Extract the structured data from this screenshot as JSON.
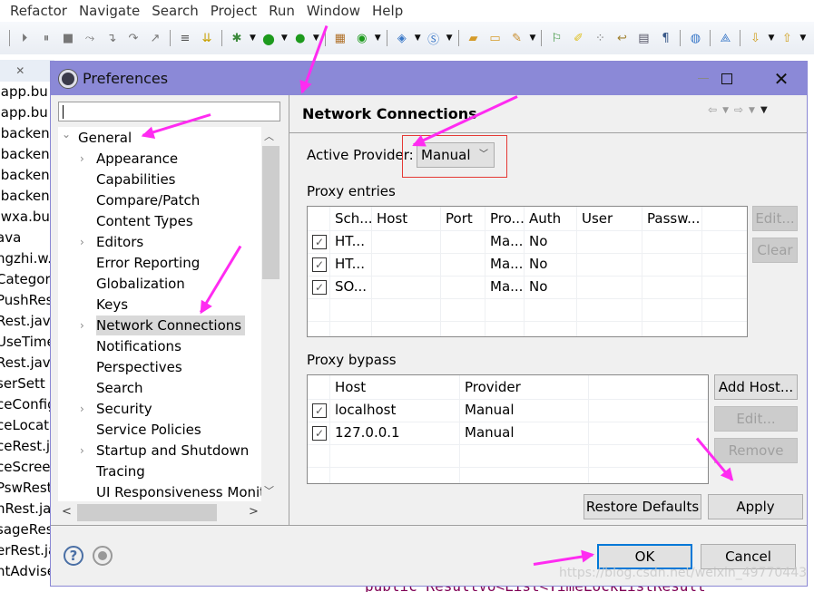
{
  "menubar": {
    "items": [
      "Refactor",
      "Navigate",
      "Search",
      "Project",
      "Run",
      "Window",
      "Help"
    ]
  },
  "background_editor": {
    "files": [
      ".app.bu",
      ".app.bu",
      ".backen",
      ".backen",
      ".backen",
      ".backen",
      ".wxa.bu",
      "ava",
      "ngzhi.w.",
      "Categor",
      "PushRes",
      "Rest.java",
      "UseTime",
      "Rest.jav",
      "serSett",
      "ceConfig",
      "ceLocat",
      "ceRest.j",
      "ceScree",
      "PswRest",
      "nRest.ja",
      "sageRes",
      "erRest.ja",
      "ntAdvise"
    ],
    "code_line": "public ResultVo<List<TimeLockListResult"
  },
  "dialog": {
    "title": "Preferences",
    "search": {
      "value": "",
      "placeholder": ""
    },
    "tree": [
      {
        "label": "General",
        "level": 0,
        "expander": "expanded"
      },
      {
        "label": "Appearance",
        "level": 1,
        "expander": "collapsed"
      },
      {
        "label": "Capabilities",
        "level": 1,
        "expander": "none"
      },
      {
        "label": "Compare/Patch",
        "level": 1,
        "expander": "none"
      },
      {
        "label": "Content Types",
        "level": 1,
        "expander": "none"
      },
      {
        "label": "Editors",
        "level": 1,
        "expander": "collapsed"
      },
      {
        "label": "Error Reporting",
        "level": 1,
        "expander": "none"
      },
      {
        "label": "Globalization",
        "level": 1,
        "expander": "none"
      },
      {
        "label": "Keys",
        "level": 1,
        "expander": "none"
      },
      {
        "label": "Network Connections",
        "level": 1,
        "expander": "collapsed",
        "selected": true
      },
      {
        "label": "Notifications",
        "level": 1,
        "expander": "none"
      },
      {
        "label": "Perspectives",
        "level": 1,
        "expander": "none"
      },
      {
        "label": "Search",
        "level": 1,
        "expander": "none"
      },
      {
        "label": "Security",
        "level": 1,
        "expander": "collapsed"
      },
      {
        "label": "Service Policies",
        "level": 1,
        "expander": "none"
      },
      {
        "label": "Startup and Shutdown",
        "level": 1,
        "expander": "collapsed"
      },
      {
        "label": "Tracing",
        "level": 1,
        "expander": "none"
      },
      {
        "label": "UI Responsiveness Monit",
        "level": 1,
        "expander": "none"
      }
    ],
    "page": {
      "title": "Network Connections",
      "active_provider_label": "Active Provider:",
      "active_provider_value": "Manual",
      "proxy_entries_label": "Proxy entries",
      "proxy_entries_columns": [
        "Sch...",
        "Host",
        "Port",
        "Pro...",
        "Auth",
        "User",
        "Passw..."
      ],
      "proxy_entries_rows": [
        {
          "checked": true,
          "scheme": "HT...",
          "host": "",
          "port": "",
          "provider": "Ma...",
          "auth": "No",
          "user": "",
          "password": ""
        },
        {
          "checked": true,
          "scheme": "HT...",
          "host": "",
          "port": "",
          "provider": "Ma...",
          "auth": "No",
          "user": "",
          "password": ""
        },
        {
          "checked": true,
          "scheme": "SO...",
          "host": "",
          "port": "",
          "provider": "Ma...",
          "auth": "No",
          "user": "",
          "password": ""
        }
      ],
      "entries_buttons": {
        "edit": "Edit...",
        "clear": "Clear"
      },
      "proxy_bypass_label": "Proxy bypass",
      "proxy_bypass_columns": [
        "Host",
        "Provider"
      ],
      "proxy_bypass_rows": [
        {
          "checked": true,
          "host": "localhost",
          "provider": "Manual"
        },
        {
          "checked": true,
          "host": "127.0.0.1",
          "provider": "Manual"
        }
      ],
      "bypass_buttons": {
        "add_host": "Add Host...",
        "edit": "Edit...",
        "remove": "Remove"
      },
      "restore_defaults": "Restore Defaults",
      "apply": "Apply"
    },
    "footer": {
      "ok": "OK",
      "cancel": "Cancel"
    }
  },
  "watermark": "https://blog.csdn.net/weixin_49770443",
  "colors": {
    "titlebar": "#8b89d7",
    "annotation_arrow": "#ff2bf1",
    "highlight_box": "#e53935",
    "default_button_border": "#0078d7"
  }
}
